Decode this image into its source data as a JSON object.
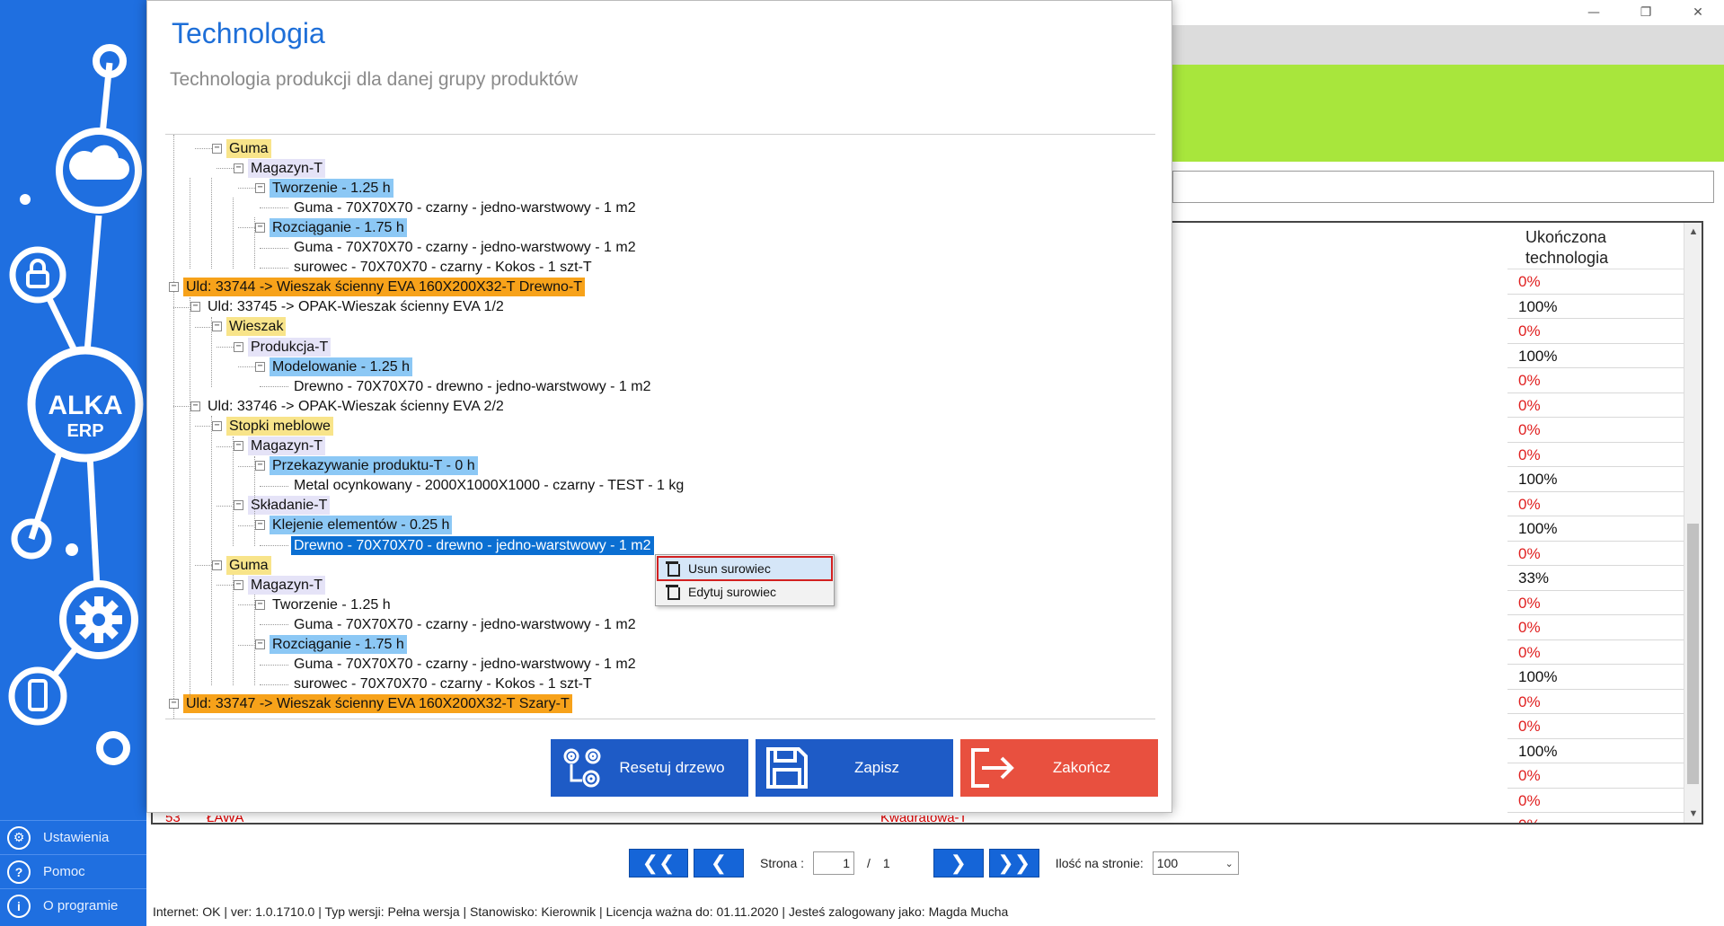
{
  "window": {
    "controls": {
      "minimize": "—",
      "restore": "❐",
      "close": "✕"
    }
  },
  "background_table": {
    "column_header": "Ukończona technologia",
    "rows": [
      "0%",
      "100%",
      "0%",
      "100%",
      "0%",
      "0%",
      "0%",
      "0%",
      "100%",
      "0%",
      "100%",
      "0%",
      "33%",
      "0%",
      "0%",
      "0%",
      "100%",
      "0%",
      "0%",
      "100%",
      "0%",
      "0%",
      "0%"
    ],
    "partial_row": {
      "num": "53",
      "name": "ŁAWA",
      "tech": "Kwadratowa-T"
    }
  },
  "sidebar": {
    "logo_top": "ALKA",
    "logo_bottom": "ERP",
    "menu": [
      {
        "icon": "gear-icon",
        "label": "Ustawienia"
      },
      {
        "icon": "help-icon",
        "label": "Pomoc"
      },
      {
        "icon": "info-icon",
        "label": "O programie"
      }
    ]
  },
  "dialog": {
    "title": "Technologia",
    "subtitle": "Technologia produkcji dla danej grupy produktów",
    "tree": [
      {
        "text": "Guma",
        "style": "yellow",
        "toggle": "⊟"
      },
      {
        "text": "Magazyn-T",
        "style": "lavender",
        "toggle": "⊟"
      },
      {
        "text": "Tworzenie - 1.25 h",
        "style": "blue",
        "toggle": "⊟"
      },
      {
        "text": "Guma - 70X70X70 -  czarny -  jedno-warstwowy - 1 m2",
        "style": "none",
        "toggle": ""
      },
      {
        "text": "Rozciąganie - 1.75 h",
        "style": "blue",
        "toggle": "⊟"
      },
      {
        "text": "Guma - 70X70X70 -  czarny -  jedno-warstwowy - 1 m2",
        "style": "none",
        "toggle": ""
      },
      {
        "text": "surowec - 70X70X70 -  czarny -  Kokos - 1 szt-T",
        "style": "none",
        "toggle": ""
      },
      {
        "text": "Uld: 33744 -> Wieszak ścienny EVA 160X200X32-T Drewno-T",
        "style": "orange",
        "toggle": "⊟"
      },
      {
        "text": "Uld: 33745 -> OPAK-Wieszak ścienny EVA   1/2",
        "style": "none",
        "toggle": "⊟"
      },
      {
        "text": "Wieszak",
        "style": "yellow",
        "toggle": "⊟"
      },
      {
        "text": "Produkcja-T",
        "style": "lavender",
        "toggle": "⊟"
      },
      {
        "text": "Modelowanie - 1.25 h",
        "style": "blue",
        "toggle": "⊟"
      },
      {
        "text": "Drewno - 70X70X70 -  drewno -  jedno-warstwowy - 1 m2",
        "style": "none",
        "toggle": ""
      },
      {
        "text": "Uld: 33746 -> OPAK-Wieszak ścienny EVA   2/2",
        "style": "none",
        "toggle": "⊟"
      },
      {
        "text": "Stopki meblowe",
        "style": "yellow",
        "toggle": "⊟"
      },
      {
        "text": "Magazyn-T",
        "style": "lavender",
        "toggle": "⊟"
      },
      {
        "text": "Przekazywanie produktu-T - 0 h",
        "style": "blue",
        "toggle": "⊟"
      },
      {
        "text": "Metal ocynkowany - 2000X1000X1000 -  czarny -  TEST - 1 kg",
        "style": "none",
        "toggle": ""
      },
      {
        "text": "Składanie-T",
        "style": "lavender",
        "toggle": "⊟"
      },
      {
        "text": "Klejenie elementów - 0.25 h",
        "style": "blue",
        "toggle": "⊟"
      },
      {
        "text": "Drewno - 70X70X70 -  drewno -  jedno-warstwowy - 1 m2",
        "style": "selected",
        "toggle": ""
      },
      {
        "text": "Guma",
        "style": "yellow",
        "toggle": "⊟"
      },
      {
        "text": "Magazyn-T",
        "style": "lavender",
        "toggle": "⊟"
      },
      {
        "text": "Tworzenie - 1.25 h",
        "style": "none",
        "toggle": "⊟"
      },
      {
        "text": "Guma - 70X70X70 -  czarny -  jedno-warstwowy - 1 m2",
        "style": "none",
        "toggle": ""
      },
      {
        "text": "Rozciąganie - 1.75 h",
        "style": "blue",
        "toggle": "⊟"
      },
      {
        "text": "Guma - 70X70X70 -  czarny -  jedno-warstwowy - 1 m2",
        "style": "none",
        "toggle": ""
      },
      {
        "text": "surowec - 70X70X70 -  czarny -  Kokos - 1 szt-T",
        "style": "none",
        "toggle": ""
      },
      {
        "text": "Uld: 33747 -> Wieszak ścienny EVA 160X200X32-T Szary-T",
        "style": "orange",
        "toggle": "⊟"
      }
    ],
    "context_menu": [
      {
        "label": "Usun surowiec",
        "icon": "trash-icon"
      },
      {
        "label": "Edytuj surowiec",
        "icon": "trash-icon"
      }
    ],
    "buttons": {
      "reset": "Resetuj drzewo",
      "save": "Zapisz",
      "exit": "Zakończ"
    }
  },
  "pager": {
    "first": "❮❮",
    "prev": "❮",
    "page_label": "Strona :",
    "page_value": "1",
    "separator": "/",
    "total_pages": "1",
    "next": "❯",
    "last": "❯❯",
    "per_page_label": "Ilość na stronie:",
    "per_page_value": "100"
  },
  "statusbar": {
    "text": "Internet: OK  |   ver: 1.0.1710.0   |   Typ wersji: Pełna wersja   |   Stanowisko: Kierownik   |   Licencja ważna do: 01.11.2020   |   Jesteś zalogowany jako: Magda Mucha"
  },
  "colors": {
    "accent_blue": "#1f6fe0",
    "title_blue": "#1e6fd8",
    "green_strip": "#a8e63c",
    "exit_red": "#e8503f",
    "zero_red": "#e02020"
  }
}
